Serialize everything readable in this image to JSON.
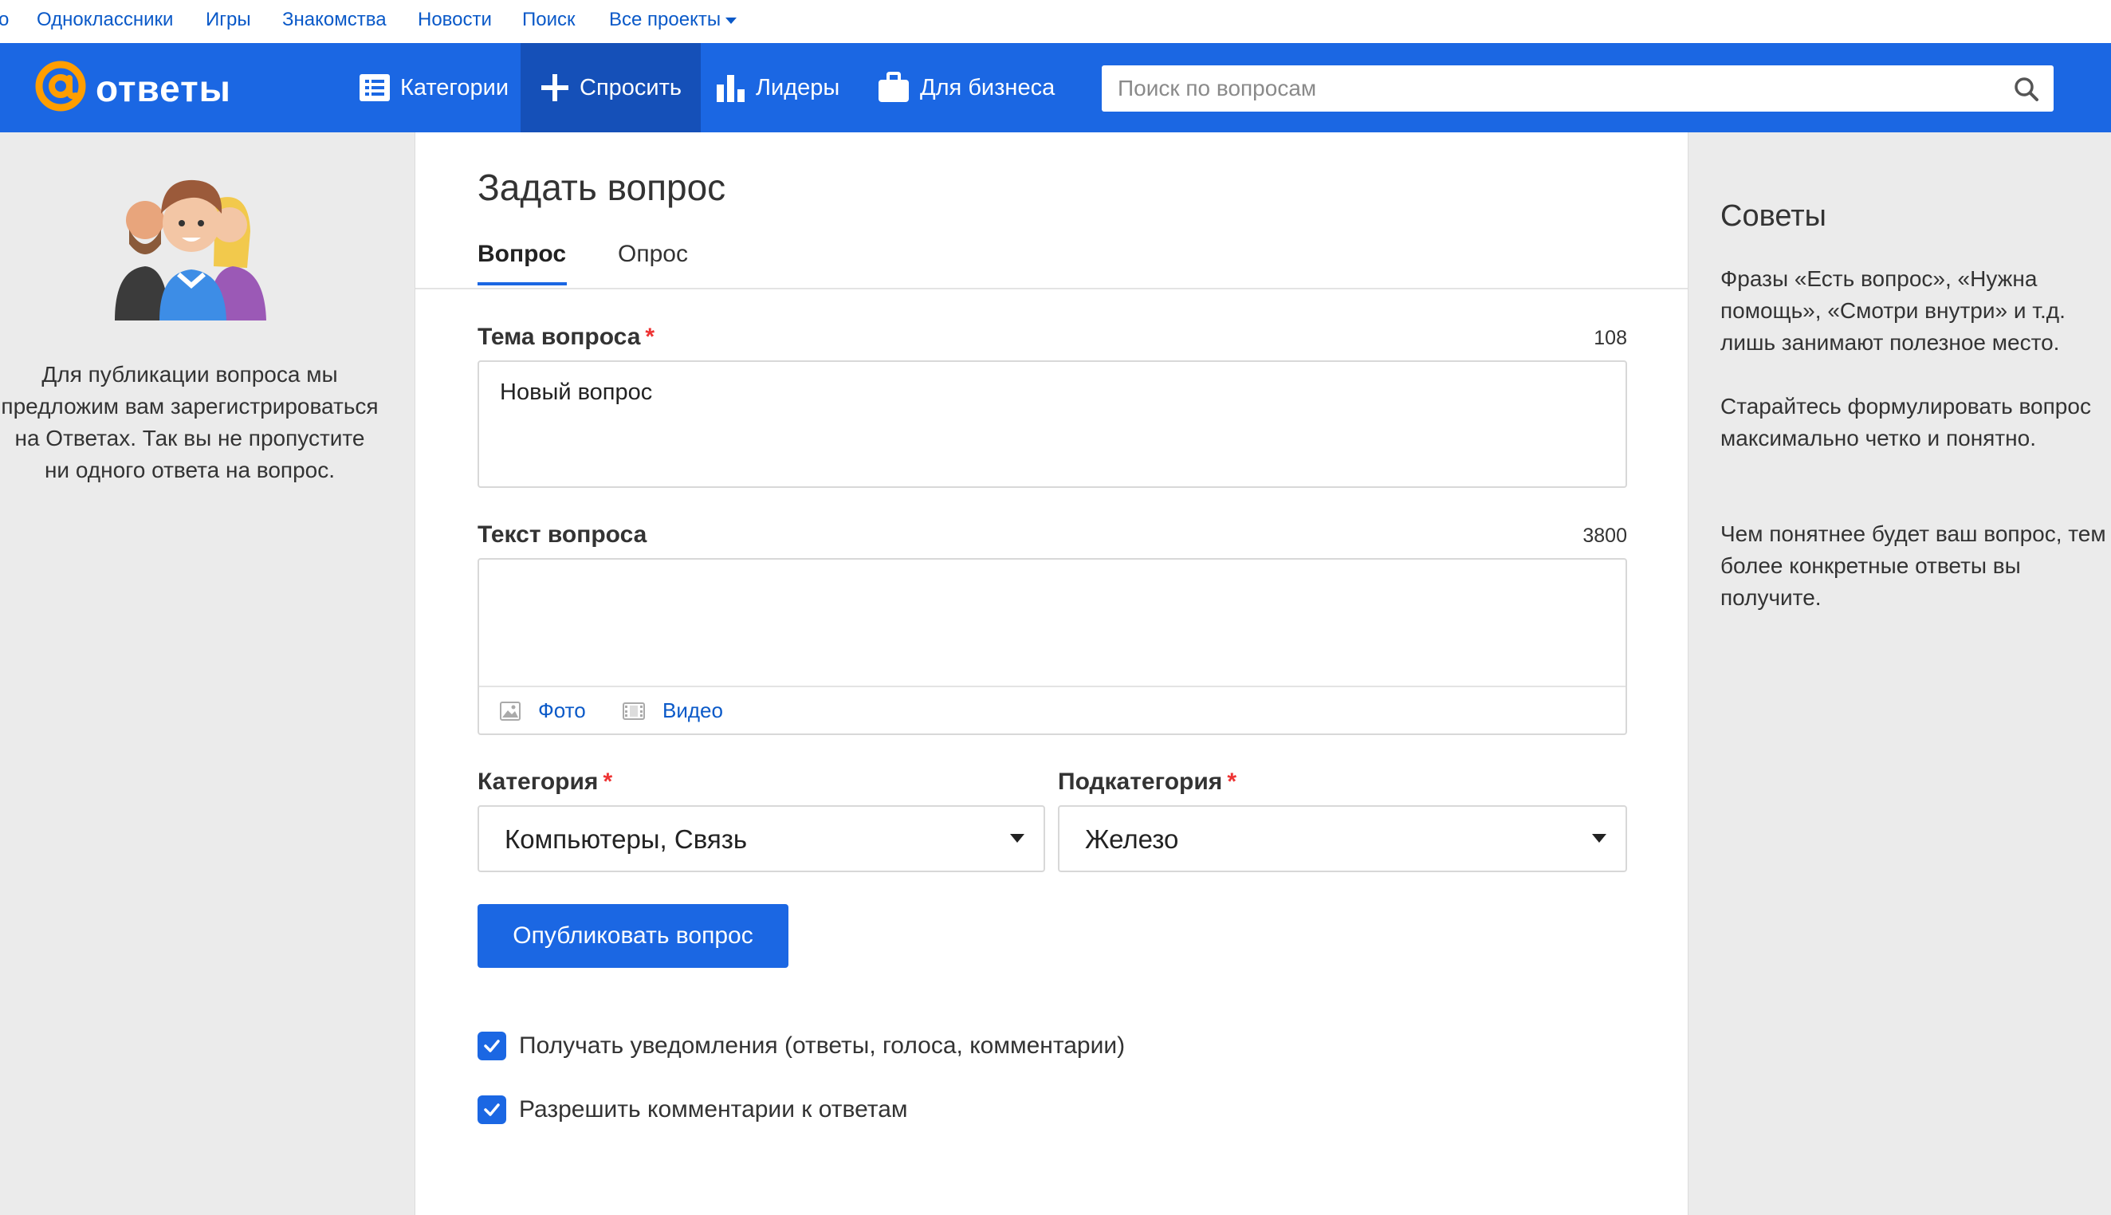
{
  "projects_bar": {
    "items": [
      "о",
      "Одноклассники",
      "Игры",
      "Знакомства",
      "Новости",
      "Поиск",
      "Все проекты"
    ]
  },
  "header": {
    "logo_text": "ответы",
    "nav": [
      {
        "label": "Категории",
        "icon": "list-icon"
      },
      {
        "label": "Спросить",
        "icon": "plus-icon"
      },
      {
        "label": "Лидеры",
        "icon": "bar-chart-icon"
      },
      {
        "label": "Для бизнеса",
        "icon": "briefcase-icon"
      }
    ],
    "search_placeholder": "Поиск по вопросам",
    "colors": {
      "header_bg": "#1b67e3",
      "active_nav": "#1550b8"
    }
  },
  "left": {
    "info_text": "Для публикации вопроса мы предложим вам зарегистрироваться на Ответах. Так вы не пропустите ни одного ответа на вопрос."
  },
  "form": {
    "title": "Задать вопрос",
    "tabs": [
      {
        "label": "Вопрос",
        "active": true
      },
      {
        "label": "Опрос",
        "active": false
      }
    ],
    "topic": {
      "label": "Тема вопроса",
      "required_mark": "*",
      "counter": "108",
      "value": "Новый вопрос"
    },
    "body": {
      "label": "Текст вопроса",
      "counter": "3800",
      "value": "",
      "attach_photo": "Фото",
      "attach_video": "Видео"
    },
    "category": {
      "label": "Категория",
      "required_mark": "*",
      "selected": "Компьютеры, Связь"
    },
    "subcategory": {
      "label": "Подкатегория",
      "required_mark": "*",
      "selected": "Железо"
    },
    "publish_label": "Опубликовать вопрос",
    "checkboxes": [
      {
        "label": "Получать уведомления (ответы, голоса, комментарии)",
        "checked": true
      },
      {
        "label": "Разрешить комментарии к ответам",
        "checked": true
      }
    ]
  },
  "tips": {
    "title": "Советы",
    "items": [
      "Фразы «Есть вопрос», «Нужна помощь», «Смотри внутри» и т.д. лишь занимают полезное место.",
      "Старайтесь формулировать вопрос максимально четко и понятно.",
      "Чем понятнее будет ваш вопрос, тем более конкретные ответы вы получите."
    ]
  }
}
